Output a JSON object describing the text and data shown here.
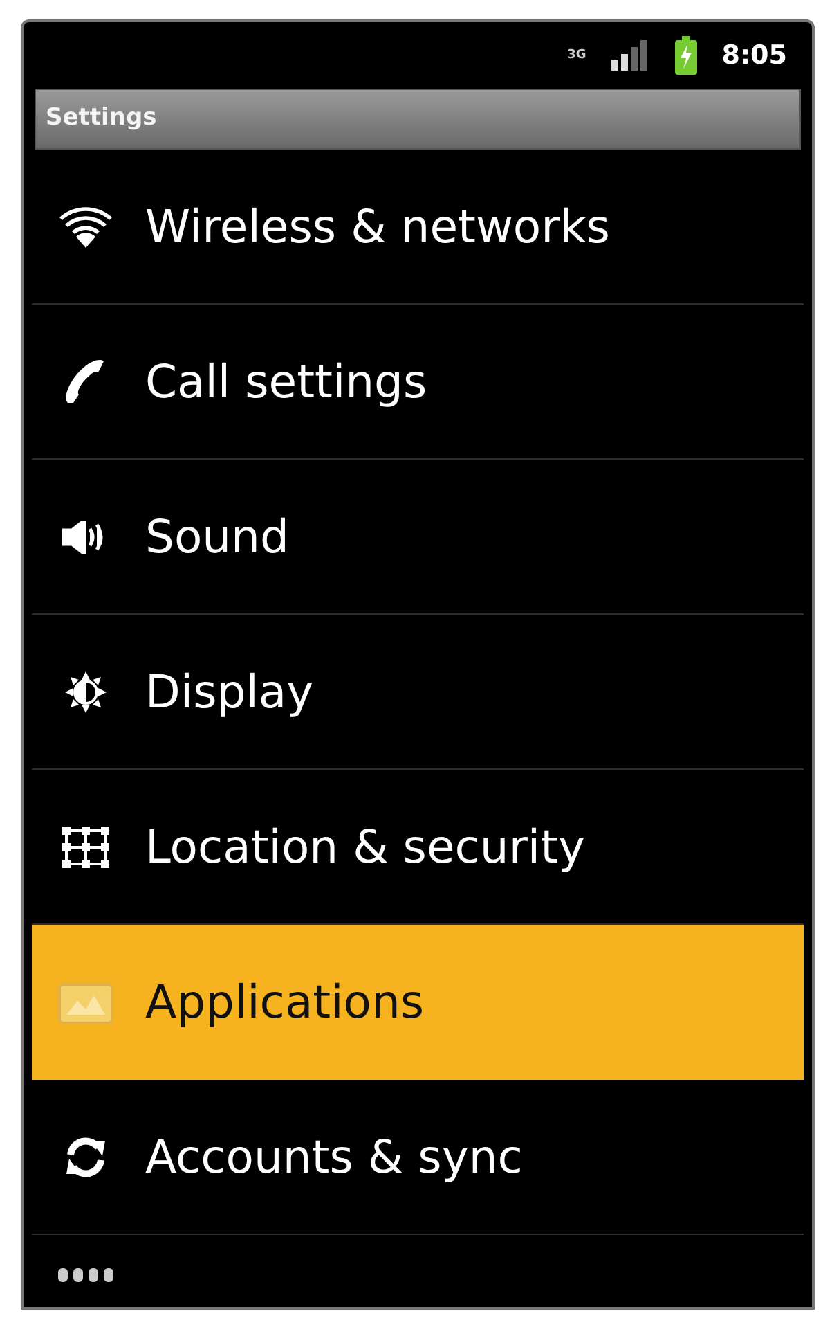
{
  "status_bar": {
    "network": "3G",
    "time": "8:05"
  },
  "title_bar": {
    "title": "Settings"
  },
  "settings": [
    {
      "kind": "wifi",
      "label": "Wireless & networks",
      "selected": false
    },
    {
      "kind": "phone",
      "label": "Call settings",
      "selected": false
    },
    {
      "kind": "speaker",
      "label": "Sound",
      "selected": false
    },
    {
      "kind": "brightness",
      "label": "Display",
      "selected": false
    },
    {
      "kind": "grid",
      "label": "Location & security",
      "selected": false
    },
    {
      "kind": "apps",
      "label": "Applications",
      "selected": true
    },
    {
      "kind": "sync",
      "label": "Accounts & sync",
      "selected": false
    },
    {
      "kind": "dots",
      "selected": false
    }
  ]
}
